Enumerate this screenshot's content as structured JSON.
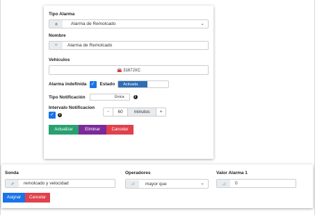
{
  "form": {
    "tipo_alarma": {
      "label": "Tipo Alarma",
      "value": "Alarma de Remolcado",
      "icon": "bell-icon"
    },
    "nombre": {
      "label": "Nombre",
      "value": "Alarma de Remolcado",
      "icon": "lines-icon"
    },
    "vehiculos": {
      "label": "Vehiculos",
      "value": "3167JXC",
      "icon": "car-icon"
    },
    "alarma_indefinida": {
      "label": "Alarma indefinida",
      "checked": true
    },
    "estado": {
      "label": "Estado",
      "value": "Activada"
    },
    "tipo_notificacion": {
      "label": "Tipo Notificación",
      "value": "Única"
    },
    "intervalo": {
      "label": "Intervalo Notificacion",
      "minus": "-",
      "value": "60",
      "unit": "minutos",
      "plus": "+",
      "checked": true
    },
    "buttons": {
      "actualizar": "Actualizar",
      "eliminar": "Eliminar",
      "cancelar": "Cancelar"
    }
  },
  "condition": {
    "sonda": {
      "label": "Sonda",
      "value": "remolcado y velocidad",
      "icon": "pin-icon"
    },
    "operadores": {
      "label": "Operadores",
      "value": "mayor que",
      "icon": "sort-icon"
    },
    "valor": {
      "label": "Valor Alarma 1",
      "value": "0",
      "icon": "bars-icon"
    },
    "buttons": {
      "asignar": "Asignar",
      "cancelar": "Cancelar"
    }
  },
  "colors": {
    "primary": "#1a73e8",
    "success": "#28a070",
    "danger": "#e0414b",
    "purple": "#7b2a9a",
    "toggle": "#2f6eb5"
  }
}
